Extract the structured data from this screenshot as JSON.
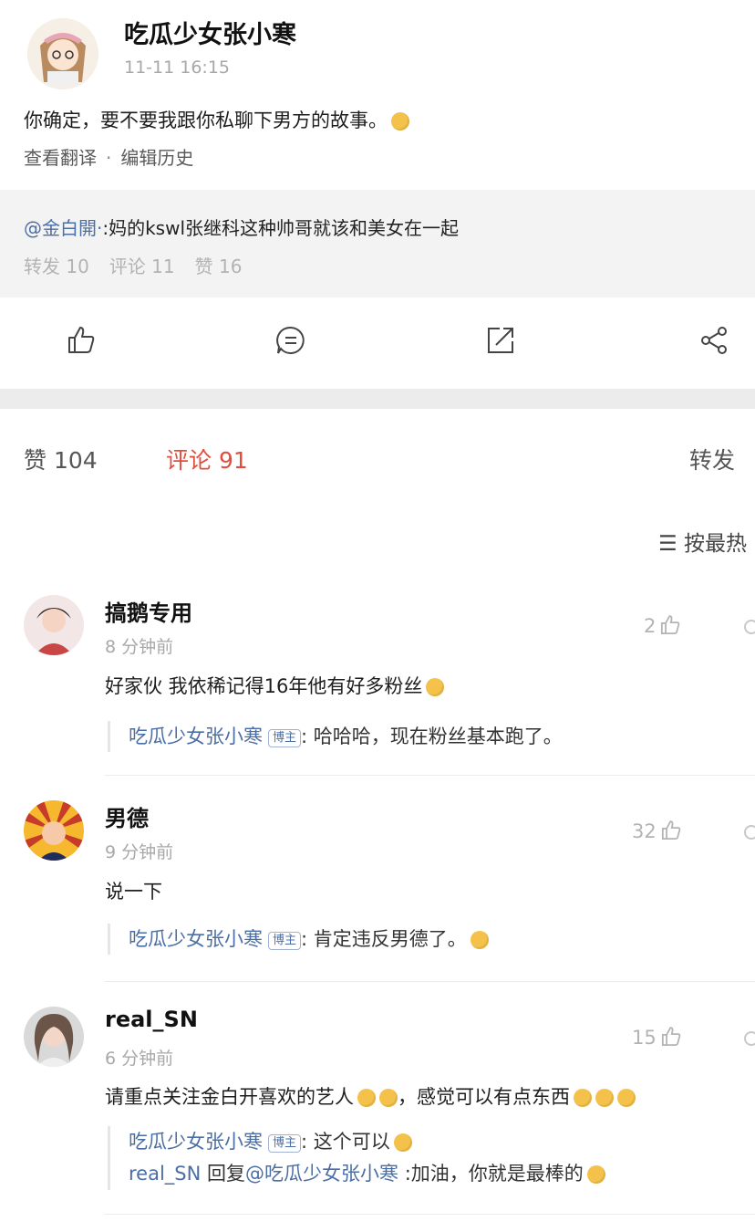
{
  "post": {
    "author": "吃瓜少女张小寒",
    "time": "11-11 16:15",
    "text": "你确定，要不要我跟你私聊下男方的故事。",
    "links": {
      "translate": "查看翻译",
      "separator": "·",
      "edit_history": "编辑历史"
    }
  },
  "repost": {
    "mention": "@金白開·",
    "text": ":妈的kswl张继科这种帅哥就该和美女在一起",
    "stats": {
      "forward": "转发 10",
      "comment": "评论 11",
      "like": "赞 16"
    }
  },
  "actions": [
    "like-icon",
    "comment-icon",
    "forward-icon",
    "share-icon"
  ],
  "tabs": {
    "likes": "赞 104",
    "comments": "评论 91",
    "forwards": "转发"
  },
  "sort": {
    "icon": "sort-icon",
    "label": "按最热"
  },
  "comments": [
    {
      "name": "搞鹅专用",
      "time": "8 分钟前",
      "likes": "2",
      "text": "好家伙 我依稀记得16年他有好多粉丝",
      "replies": [
        {
          "user": "吃瓜少女张小寒",
          "badge": "博主",
          "text": ": 哈哈哈，现在粉丝基本跑了。"
        }
      ]
    },
    {
      "name": "男德",
      "time": "9 分钟前",
      "likes": "32",
      "text": "说一下",
      "replies": [
        {
          "user": "吃瓜少女张小寒",
          "badge": "博主",
          "text": ": 肯定违反男德了。"
        }
      ]
    },
    {
      "name": "real_SN",
      "time": "6 分钟前",
      "likes": "15",
      "text": "请重点关注金白开喜欢的艺人",
      "text2": "，感觉可以有点东西",
      "replies": [
        {
          "user": "吃瓜少女张小寒",
          "badge": "博主",
          "text": ": 这个可以"
        },
        {
          "user": "real_SN",
          "mid": " 回复",
          "mention": "@吃瓜少女张小寒",
          "text": " :加油，你就是最棒的"
        }
      ]
    }
  ],
  "colors": {
    "accent": "#e24d3d",
    "link": "#4b6ea4"
  }
}
